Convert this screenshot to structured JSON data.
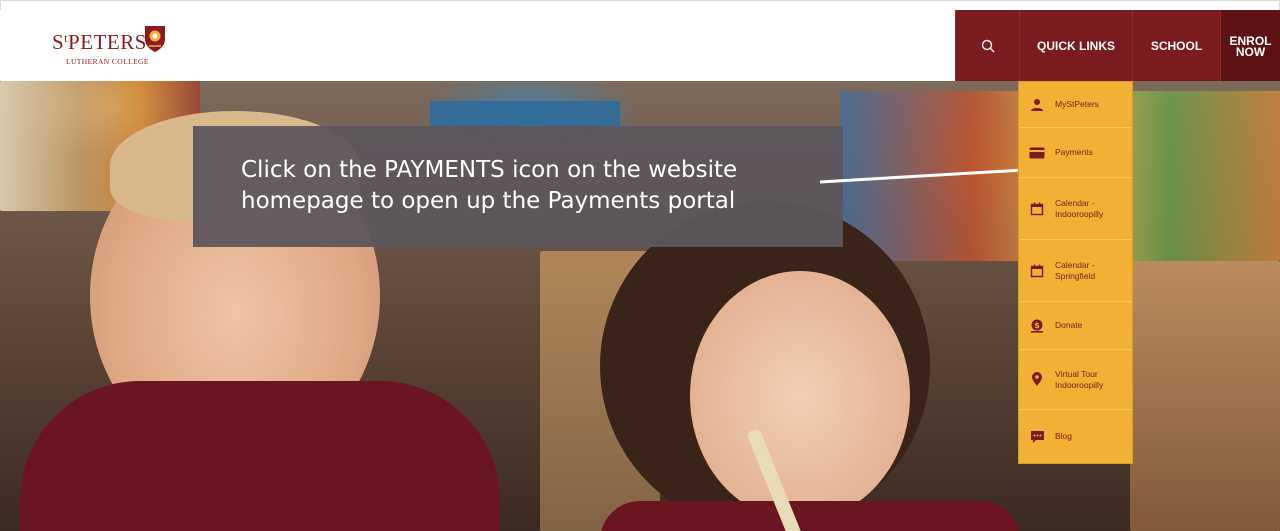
{
  "logo": {
    "word_prefix": "S",
    "word_sup": "t",
    "word_main": "PETERS",
    "subtitle": "LUTHERAN COLLEGE"
  },
  "nav": {
    "search_icon": "search-icon",
    "quick_links": "QUICK LINKS",
    "school": "SCHOOL",
    "enrol_line1": "ENROL",
    "enrol_line2": "NOW"
  },
  "annotation": {
    "line1": "Click on the PAYMENTS icon on the website",
    "line2": "homepage to open up the Payments portal"
  },
  "quick_links": {
    "items": [
      {
        "label": "MyStPeters",
        "icon": "person-icon"
      },
      {
        "label": "Payments",
        "icon": "credit-card-icon"
      },
      {
        "label": "Calendar - Indooroopilly",
        "icon": "calendar-icon"
      },
      {
        "label": "Calendar - Springfield",
        "icon": "calendar-icon"
      },
      {
        "label": "Donate",
        "icon": "dollar-coin-icon"
      },
      {
        "label": "Virtual Tour Indooroopilly",
        "icon": "map-pin-icon"
      },
      {
        "label": "Blog",
        "icon": "chat-bubble-icon"
      }
    ]
  },
  "colors": {
    "brand_maroon": "#7a1b1f",
    "enrol_dark": "#5e1216",
    "dropdown_gold": "#f2b134",
    "annotation_bg": "#5c565c"
  }
}
